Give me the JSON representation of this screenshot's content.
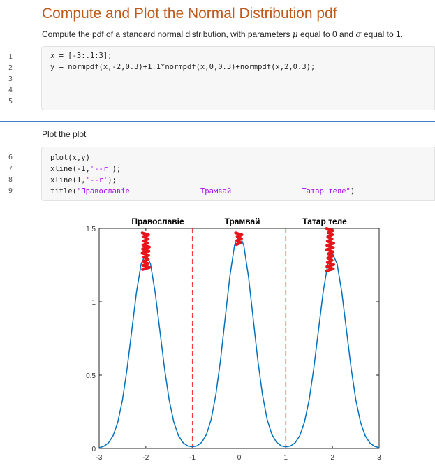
{
  "header": {
    "title": "Compute and Plot the Normal Distribution pdf",
    "description_prefix": "Compute the pdf of a standard normal distribution, with parameters ",
    "mu_symbol": "μ",
    "description_middle": " equal to 0 and ",
    "sigma_symbol": "σ",
    "description_suffix": " equal to 1."
  },
  "code_block_1": {
    "line_numbers": [
      "1",
      "2",
      "3",
      "4",
      "5"
    ],
    "lines": [
      "x = [-3:.1:3];",
      "y = normpdf(x,-2,0.3)+1.1*normpdf(x,0,0.3)+normpdf(x,2,0.3);",
      "",
      "",
      ""
    ]
  },
  "section_2": {
    "text": "Plot the plot"
  },
  "code_block_2": {
    "line_numbers": [
      "6",
      "7",
      "8",
      "9"
    ],
    "line_6": "plot(x,y)",
    "line_7_prefix": "xline(-1,",
    "line_7_string": "'--r'",
    "line_7_suffix": ");",
    "line_8_prefix": "xline(1,",
    "line_8_string": "'--r'",
    "line_8_suffix": ");",
    "line_9_prefix": "title(",
    "line_9_string": "\"Православіе                Трамвай                Татар теле\"",
    "line_9_suffix": ")"
  },
  "chart_data": {
    "type": "line",
    "title_parts": [
      "Православіе",
      "Трамвай",
      "Татар теле"
    ],
    "xlabel": "",
    "ylabel": "",
    "xlim": [
      -3,
      3
    ],
    "ylim": [
      0,
      1.5
    ],
    "xticks": [
      "-3",
      "-2",
      "-1",
      "0",
      "1",
      "2",
      "3"
    ],
    "yticks": [
      "0",
      "0.5",
      "1",
      "1.5"
    ],
    "xticks_values": [
      -3,
      -2,
      -1,
      0,
      1,
      2,
      3
    ],
    "yticks_values": [
      0,
      0.5,
      1,
      1.5
    ],
    "series": [
      {
        "x_start": -3,
        "x_step": 0.1,
        "x_end": 3,
        "peaks": [
          {
            "mu": -2,
            "sigma": 0.3,
            "weight": 1.0
          },
          {
            "mu": 0,
            "sigma": 0.3,
            "weight": 1.1
          },
          {
            "mu": 2,
            "sigma": 0.3,
            "weight": 1.0
          }
        ],
        "color": "#0072bd"
      }
    ],
    "vlines": [
      {
        "x": -1,
        "color": "#ff3b3b",
        "style": "dashed"
      },
      {
        "x": 1,
        "color": "#ff3b3b",
        "style": "dashed"
      }
    ],
    "annotations": [
      {
        "name": "red-scribble-1",
        "x": -2.0,
        "y_top": 1.47,
        "y_bottom": 1.22,
        "color": "#e8141b"
      },
      {
        "name": "red-scribble-2",
        "x": 0.0,
        "y_top": 1.47,
        "y_bottom": 1.39,
        "color": "#e8141b"
      },
      {
        "name": "red-scribble-3",
        "x": 1.95,
        "y_top": 1.5,
        "y_bottom": 1.21,
        "color": "#e8141b"
      }
    ],
    "grid": false,
    "legend": "none"
  },
  "colors": {
    "title": "#c05a1c",
    "divider": "#3d7fc2",
    "line": "#0072bd",
    "vline": "#ff3b3b",
    "string": "#a709f5",
    "annotation": "#e8141b"
  }
}
